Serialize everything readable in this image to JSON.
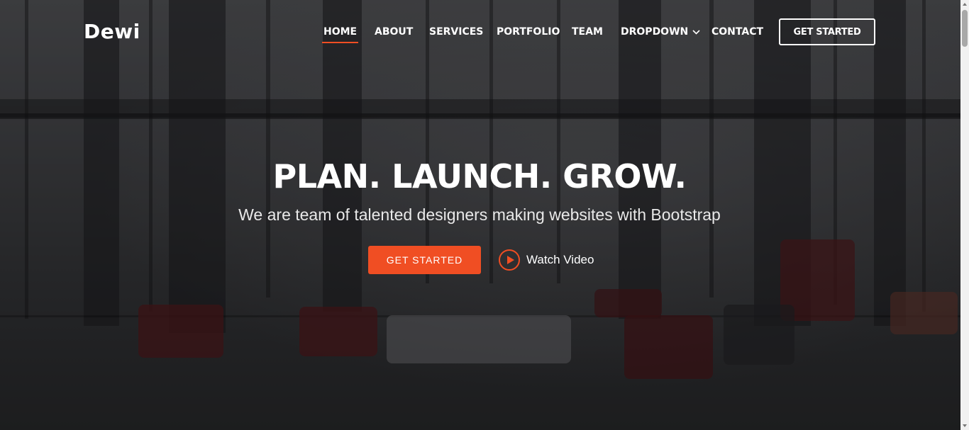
{
  "brand": {
    "name": "Dewi"
  },
  "nav": {
    "items": [
      {
        "label": "HOME",
        "active": true
      },
      {
        "label": "ABOUT",
        "active": false
      },
      {
        "label": "SERVICES",
        "active": false
      },
      {
        "label": "PORTFOLIO",
        "active": false
      },
      {
        "label": "TEAM",
        "active": false
      },
      {
        "label": "DROPDOWN",
        "active": false,
        "icon": "chevron-down-icon"
      },
      {
        "label": "CONTACT",
        "active": false
      }
    ],
    "cta_label": "GET STARTED"
  },
  "hero": {
    "title": "PLAN. LAUNCH. GROW.",
    "subtitle": "We are team of talented designers making websites with Bootstrap",
    "primary_button": "GET STARTED",
    "video_label": "Watch Video",
    "video_icon": "play-circle-icon"
  },
  "colors": {
    "accent": "#f04e23",
    "text": "#ffffff"
  }
}
